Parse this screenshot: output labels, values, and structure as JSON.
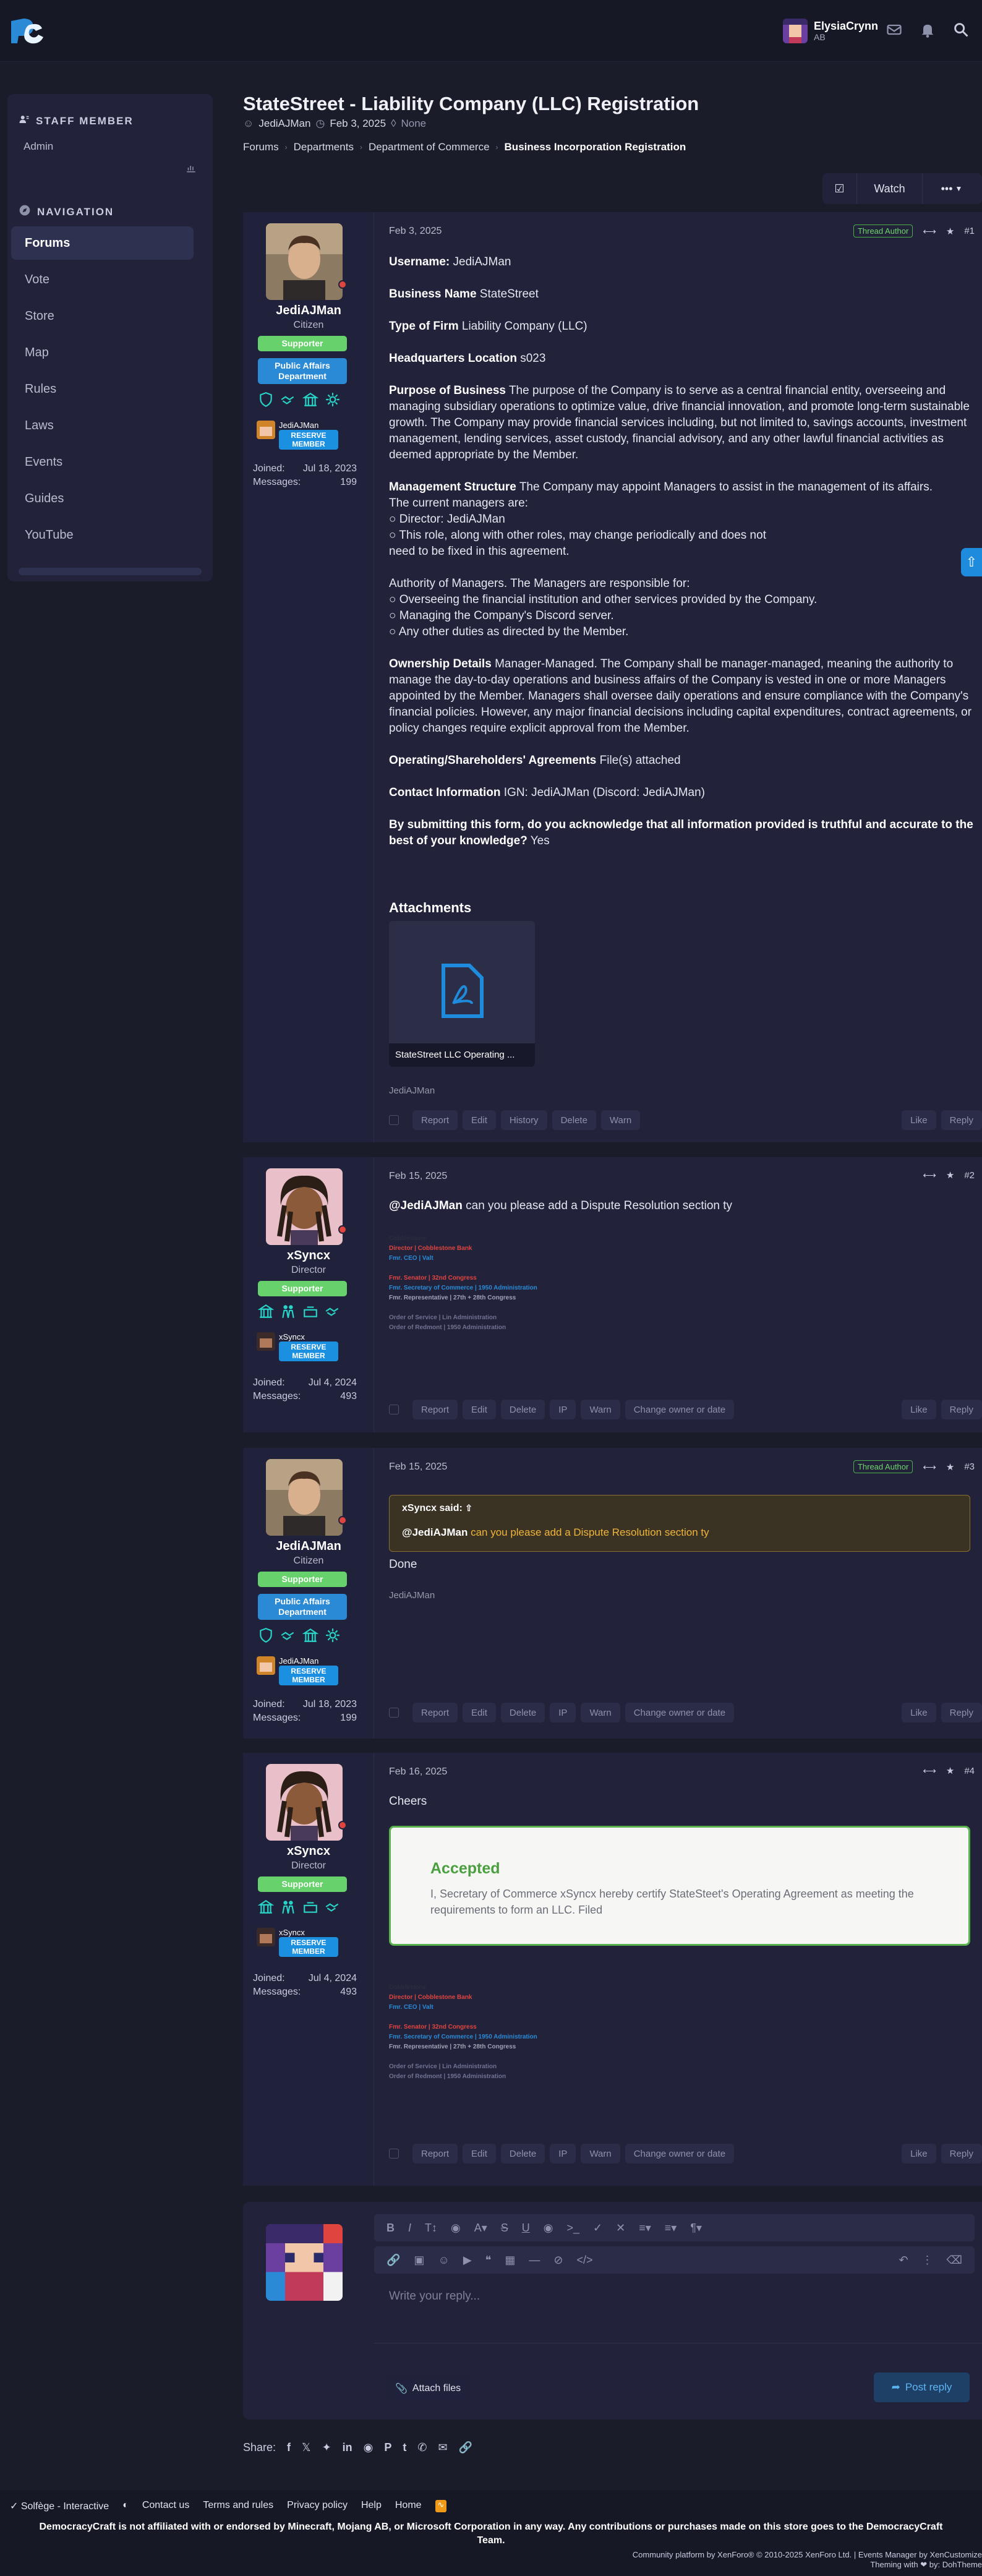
{
  "header": {
    "username": "ElysiaCrynn",
    "user_sub": "AB"
  },
  "sidebar": {
    "staff_title": "STAFF MEMBER",
    "staff_item": "Admin",
    "nav_title": "NAVIGATION",
    "items": [
      {
        "label": "Forums",
        "active": true
      },
      {
        "label": "Vote"
      },
      {
        "label": "Store"
      },
      {
        "label": "Map"
      },
      {
        "label": "Rules"
      },
      {
        "label": "Laws"
      },
      {
        "label": "Events"
      },
      {
        "label": "Guides"
      },
      {
        "label": "YouTube"
      }
    ]
  },
  "thread": {
    "title": "StateStreet - Liability Company (LLC) Registration",
    "author": "JediAJMan",
    "date": "Feb 3, 2025",
    "tags": "None",
    "breadcrumb": [
      "Forums",
      "Departments",
      "Department of Commerce",
      "Business Incorporation Registration"
    ],
    "watch_label": "Watch",
    "more_label": "•••"
  },
  "posts": [
    {
      "user": "JediAJMan",
      "role": "Citizen",
      "badges": [
        "Supporter",
        "Public Affairs Department"
      ],
      "party_name": "JediAJMan",
      "party_badge": "RESERVE MEMBER",
      "joined_label": "Joined:",
      "joined": "Jul 18, 2023",
      "messages_label": "Messages:",
      "messages": "199",
      "date": "Feb 3, 2025",
      "author_tag": "Thread Author",
      "number": "#1",
      "fields": [
        {
          "k": "Username:",
          "v": "JediAJMan"
        },
        {
          "k": "Business Name",
          "v": "StateStreet"
        },
        {
          "k": "Type of Firm",
          "v": "Liability Company (LLC)"
        },
        {
          "k": "Headquarters Location",
          "v": "s023"
        },
        {
          "k": "Purpose of Business",
          "v": "The purpose of the Company is to serve as a central financial entity, overseeing and managing subsidiary operations to optimize value, drive financial innovation, and promote long-term sustainable growth. The Company may provide financial services including, but not limited to, savings accounts, investment management, lending services, asset custody, financial advisory, and any other lawful financial activities as deemed appropriate by the Member."
        },
        {
          "k": "Management Structure",
          "v": "The Company may appoint Managers to assist in the management of its affairs."
        }
      ],
      "mgmt_lines": [
        "The current managers are:",
        "○ Director: JediAJMan",
        "○ This role, along with other roles, may change periodically and does not",
        "need to be fixed in this agreement."
      ],
      "authority_lines": [
        "Authority of Managers. The Managers are responsible for:",
        "○ Overseeing the financial institution and other services provided by the Company.",
        "○ Managing the Company's Discord server.",
        "○ Any other duties as directed by the Member."
      ],
      "fields2": [
        {
          "k": "Ownership Details",
          "v": "Manager-Managed. The Company shall be manager-managed, meaning the authority to manage the day-to-day operations and business affairs of the Company is vested in one or more Managers appointed by the Member. Managers shall oversee daily operations and ensure compliance with the Company's financial policies. However, any major financial decisions including capital expenditures, contract agreements, or policy changes require explicit approval from the Member."
        },
        {
          "k": "Operating/Shareholders' Agreements",
          "v": "File(s) attached"
        },
        {
          "k": "Contact Information",
          "v": "IGN: JediAJMan (Discord: JediAJMan)"
        },
        {
          "k": "By submitting this form, do you acknowledge that all information provided is truthful and accurate to the best of your knowledge?",
          "v": "Yes"
        }
      ],
      "attachments_title": "Attachments",
      "attachment_name": "StateStreet LLC Operating ...",
      "signature": "JediAJMan",
      "controls": [
        "Report",
        "Edit",
        "History",
        "Delete",
        "Warn"
      ]
    },
    {
      "user": "xSyncx",
      "role": "Director",
      "badges": [
        "Supporter"
      ],
      "party_name": "xSyncx",
      "party_badge": "RESERVE MEMBER",
      "joined_label": "Joined:",
      "joined": "Jul 4, 2024",
      "messages_label": "Messages:",
      "messages": "493",
      "date": "Feb 15, 2025",
      "number": "#2",
      "mention": "@JediAJMan",
      "text": "can you please add a Dispute Resolution section ty",
      "sig_lines": [
        {
          "t": "Cobblestone",
          "c": "#2a2b40"
        },
        {
          "t": "Director | Cobblestone Bank",
          "c": "#e0443e"
        },
        {
          "t": "Fmr. CEO | Valt",
          "c": "#2a8ad6"
        },
        {
          "t": "",
          "c": "#2a2b40"
        },
        {
          "t": "Fmr. Senator | 32nd Congress",
          "c": "#e0443e"
        },
        {
          "t": "Fmr. Secretary of Commerce | 1950 Administration",
          "c": "#2a8ad6"
        },
        {
          "t": "Fmr. Representative | 27th + 28th Congress",
          "c": "#9fa2b8"
        },
        {
          "t": "",
          "c": "#2a2b40"
        },
        {
          "t": "Order of Service | Lin Administration",
          "c": "#6f7290"
        },
        {
          "t": "Order of Redmont | 1950 Administration",
          "c": "#6f7290"
        }
      ],
      "controls": [
        "Report",
        "Edit",
        "Delete",
        "IP",
        "Warn",
        "Change owner or date"
      ]
    },
    {
      "user": "JediAJMan",
      "role": "Citizen",
      "badges": [
        "Supporter",
        "Public Affairs Department"
      ],
      "party_name": "JediAJMan",
      "party_badge": "RESERVE MEMBER",
      "joined_label": "Joined:",
      "joined": "Jul 18, 2023",
      "messages_label": "Messages:",
      "messages": "199",
      "date": "Feb 15, 2025",
      "author_tag": "Thread Author",
      "number": "#3",
      "quote_author": "xSyncx said:",
      "quote_mention": "@JediAJMan",
      "quote_text": "can you please add a Dispute Resolution section ty",
      "text": "Done",
      "signature": "JediAJMan",
      "controls": [
        "Report",
        "Edit",
        "Delete",
        "IP",
        "Warn",
        "Change owner or date"
      ]
    },
    {
      "user": "xSyncx",
      "role": "Director",
      "badges": [
        "Supporter"
      ],
      "party_name": "xSyncx",
      "party_badge": "RESERVE MEMBER",
      "joined_label": "Joined:",
      "joined": "Jul 4, 2024",
      "messages_label": "Messages:",
      "messages": "493",
      "date": "Feb 16, 2025",
      "number": "#4",
      "text": "Cheers",
      "accepted_title": "Accepted",
      "accepted_text": "I, Secretary of Commerce xSyncx hereby certify StateSteet's Operating Agreement as meeting the requirements to form an LLC. Filed",
      "controls": [
        "Report",
        "Edit",
        "Delete",
        "IP",
        "Warn",
        "Change owner or date"
      ]
    }
  ],
  "common": {
    "like": "Like",
    "reply": "Reply"
  },
  "reply_box": {
    "placeholder": "Write your reply...",
    "attach": "Attach files",
    "post": "Post reply"
  },
  "share_label": "Share:",
  "footer": {
    "links": [
      "Solfège - Interactive",
      "Contact us",
      "Terms and rules",
      "Privacy policy",
      "Help",
      "Home"
    ],
    "disclaimer": "DemocracyCraft is not affiliated with or endorsed by Minecraft, Mojang AB, or Microsoft Corporation in any way. Any contributions or purchases made on this store goes to the DemocracyCraft Team.",
    "copyright": "Community platform by XenForo® © 2010-2025 XenForo Ltd. | Events Manager by XenCustomize",
    "theming": "Theming with ❤ by: DohTheme"
  },
  "colors": {
    "accent": "#1f8bdc",
    "supporter": "#67d26b",
    "accepted": "#59b24e"
  }
}
